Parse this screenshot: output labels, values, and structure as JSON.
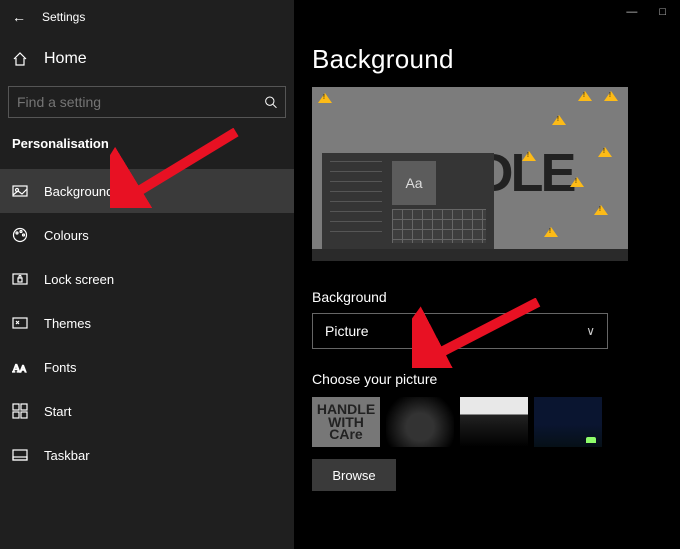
{
  "app_title": "Settings",
  "home_label": "Home",
  "search_placeholder": "Find a setting",
  "category": "Personalisation",
  "nav_items": [
    {
      "icon": "picture-icon",
      "label": "Background",
      "selected": true
    },
    {
      "icon": "palette-icon",
      "label": "Colours",
      "selected": false
    },
    {
      "icon": "lockscreen-icon",
      "label": "Lock screen",
      "selected": false
    },
    {
      "icon": "themes-icon",
      "label": "Themes",
      "selected": false
    },
    {
      "icon": "fonts-icon",
      "label": "Fonts",
      "selected": false
    },
    {
      "icon": "start-icon",
      "label": "Start",
      "selected": false
    },
    {
      "icon": "taskbar-icon",
      "label": "Taskbar",
      "selected": false
    }
  ],
  "page_heading": "Background",
  "preview_sample_text": "Aa",
  "preview_wallpaper_text": [
    "HANDLE",
    "WITH",
    "CAre"
  ],
  "dropdown_label": "Background",
  "dropdown_value": "Picture",
  "choose_label": "Choose your picture",
  "thumbnails": [
    {
      "name": "wallpaper-handle-with-care"
    },
    {
      "name": "wallpaper-dark-signature"
    },
    {
      "name": "wallpaper-cliff-bw"
    },
    {
      "name": "wallpaper-night-tent"
    }
  ],
  "browse_label": "Browse",
  "annotations": [
    {
      "target": "nav-item-background"
    },
    {
      "target": "background-dropdown"
    }
  ]
}
